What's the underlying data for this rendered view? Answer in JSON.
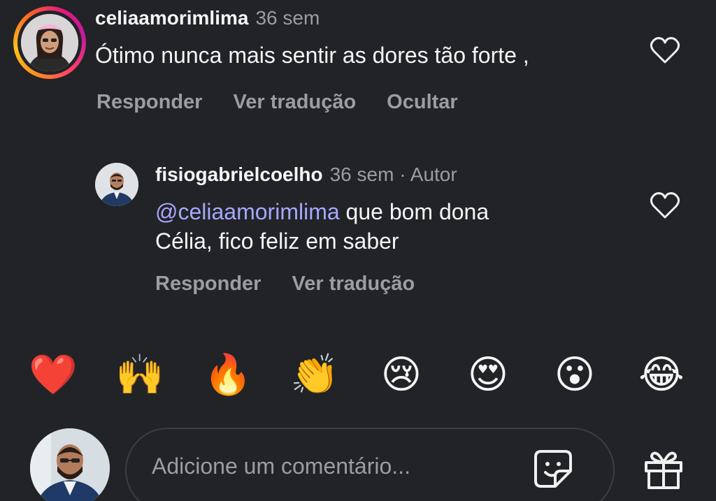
{
  "comment": {
    "username": "celiaamorimlima",
    "time": "36 sem",
    "text": "Ótimo nunca mais sentir as dores tão forte ,",
    "actions": {
      "reply": "Responder",
      "translate": "Ver tradução",
      "hide": "Ocultar"
    }
  },
  "reply": {
    "username": "fisiogabrielcoelho",
    "meta": "36 sem · Autor",
    "mention": "@celiaamorimlima",
    "text_line1": " que bom dona",
    "text_line2": "Célia, fico feliz em saber",
    "actions": {
      "reply": "Responder",
      "translate": "Ver tradução"
    }
  },
  "reactions": [
    "❤️",
    "🙌",
    "🔥",
    "👏",
    "😢",
    "😍",
    "😮",
    "😂"
  ],
  "composer": {
    "placeholder": "Adicione um comentário..."
  },
  "icons": {
    "like": "heart-outline-icon",
    "sticker": "sticker-icon",
    "gift": "gift-icon"
  },
  "colors": {
    "background": "#212327",
    "muted": "#9a9da2",
    "mention": "#a6a8ff"
  }
}
